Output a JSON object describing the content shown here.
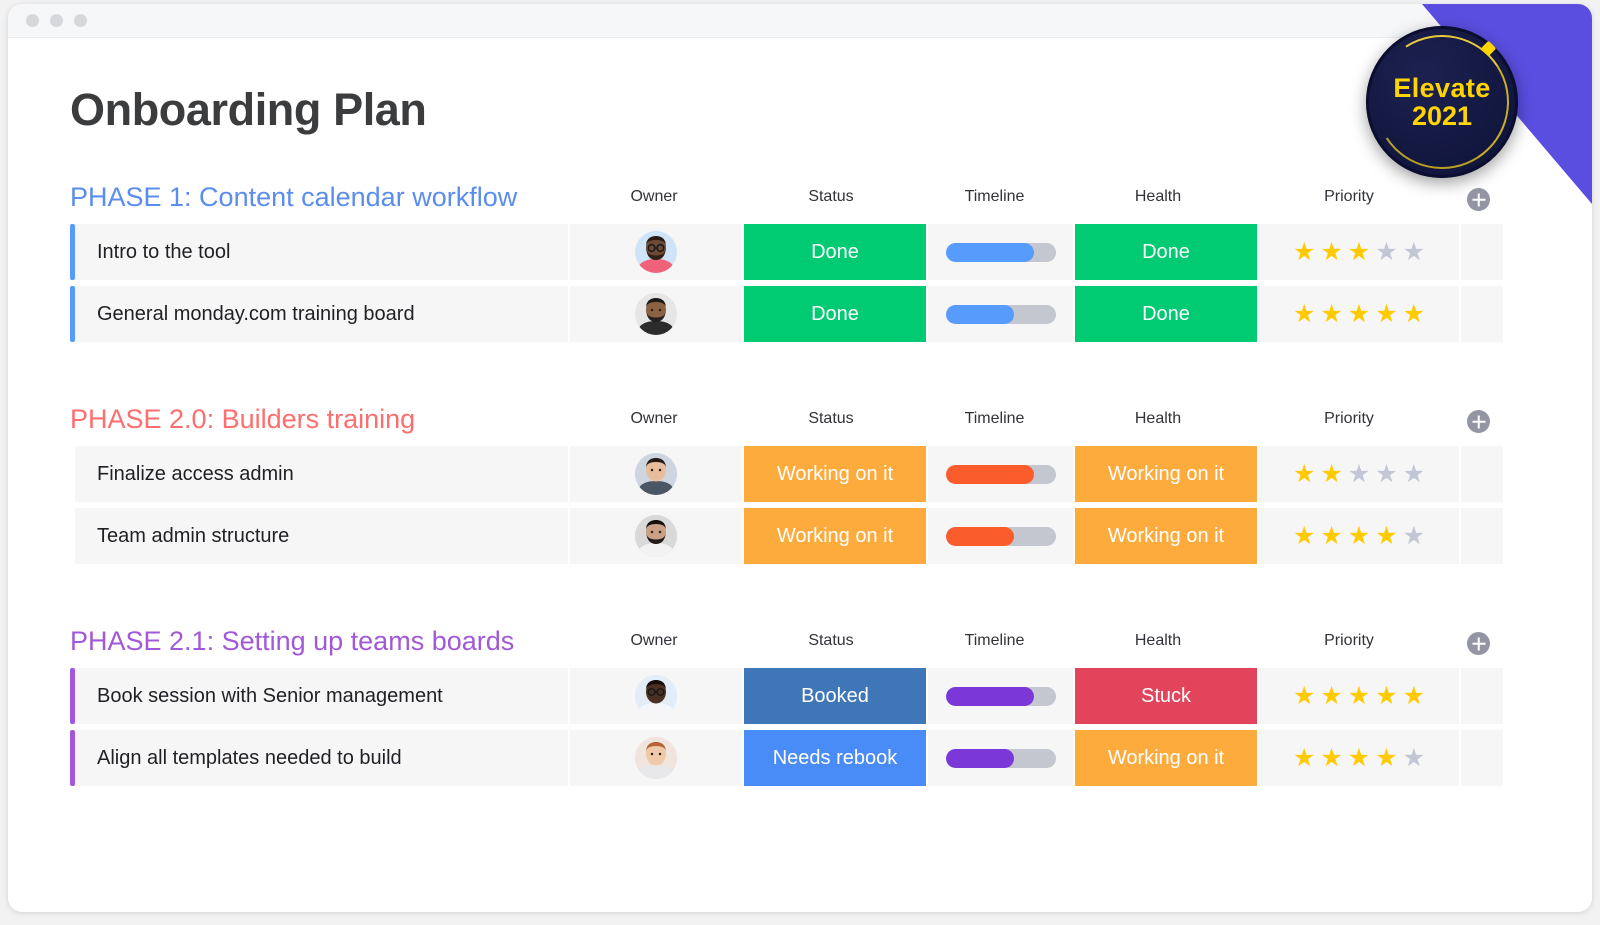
{
  "window": {
    "dots": [
      "close",
      "minimize",
      "maximize"
    ]
  },
  "badge": {
    "line1": "Elevate",
    "line2": "2021",
    "bg_color": "#141a44",
    "text_color": "#ffd400"
  },
  "corner": {
    "color": "#5a4ee0"
  },
  "header": {
    "title": "Onboarding Plan"
  },
  "columns": [
    "Owner",
    "Status",
    "Timeline",
    "Health",
    "Priority"
  ],
  "add_column_label": "+",
  "sections": [
    {
      "title": "PHASE 1: Content calendar workflow",
      "title_color": "#5b8def",
      "accent_color": "#579bfc",
      "rows": [
        {
          "name": "Intro to the tool",
          "owner": "avatar-1",
          "status": {
            "label": "Done",
            "color": "#00ca72"
          },
          "timeline": {
            "percent": 80,
            "color": "#579bfc"
          },
          "health": {
            "label": "Done",
            "color": "#00ca72"
          },
          "priority": {
            "filled": 3,
            "total": 5
          }
        },
        {
          "name": "General monday.com training board",
          "owner": "avatar-2",
          "status": {
            "label": "Done",
            "color": "#00ca72"
          },
          "timeline": {
            "percent": 62,
            "color": "#579bfc"
          },
          "health": {
            "label": "Done",
            "color": "#00ca72"
          },
          "priority": {
            "filled": 5,
            "total": 5
          }
        }
      ]
    },
    {
      "title": "PHASE 2.0: Builders training",
      "title_color": "#ff6e6e",
      "accent_color": "#f munching",
      "rows": [
        {
          "name": "Finalize access admin",
          "owner": "avatar-3",
          "status": {
            "label": "Working on it",
            "color": "#fdab3d"
          },
          "timeline": {
            "percent": 80,
            "color": "#fb5c2c"
          },
          "health": {
            "label": "Working on it",
            "color": "#fdab3d"
          },
          "priority": {
            "filled": 2,
            "total": 5
          }
        },
        {
          "name": "Team admin structure",
          "owner": "avatar-4",
          "status": {
            "label": "Working on it",
            "color": "#fdab3d"
          },
          "timeline": {
            "percent": 62,
            "color": "#fb5c2c"
          },
          "health": {
            "label": "Working on it",
            "color": "#fdab3d"
          },
          "priority": {
            "filled": 4,
            "total": 5
          }
        }
      ]
    },
    {
      "title": "PHASE 2.1: Setting up teams boards",
      "title_color": "#a259d9",
      "accent_color": "#a259d9",
      "rows": [
        {
          "name": "Book session with Senior management",
          "owner": "avatar-5",
          "status": {
            "label": "Booked",
            "color": "#3f76b8"
          },
          "timeline": {
            "percent": 80,
            "color": "#7b37d8"
          },
          "health": {
            "label": "Stuck",
            "color": "#e2445c"
          },
          "priority": {
            "filled": 5,
            "total": 5
          }
        },
        {
          "name": "Align all templates needed to build",
          "owner": "avatar-6",
          "status": {
            "label": "Needs rebook",
            "color": "#4a8cf7"
          },
          "timeline": {
            "percent": 62,
            "color": "#7b37d8"
          },
          "health": {
            "label": "Working on it",
            "color": "#fdab3d"
          },
          "priority": {
            "filled": 4,
            "total": 5
          }
        }
      ]
    }
  ]
}
